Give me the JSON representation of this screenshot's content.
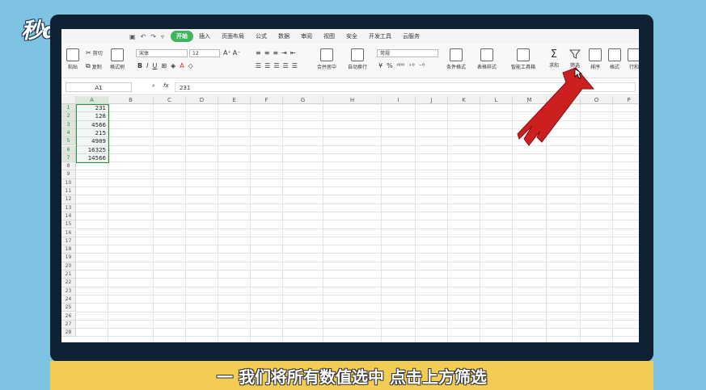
{
  "logo": {
    "text": "秒dong视频"
  },
  "ribbon": {
    "active_tab": "开始",
    "tabs": [
      "插入",
      "页面布局",
      "公式",
      "数据",
      "审阅",
      "视图",
      "安全",
      "开发工具",
      "云服务"
    ]
  },
  "toolbar": {
    "paste": "粘贴",
    "cut": "剪切",
    "copy": "复制",
    "format_painter": "格式刷",
    "font_name": "宋体",
    "font_size": "12",
    "number_format": "常规",
    "merge_center": "合并居中",
    "wrap_text": "自动换行",
    "conditional_format": "条件格式",
    "table_style": "表格样式",
    "smart_tools": "智能工具箱",
    "sum": "求和",
    "filter": "筛选",
    "sort": "排序",
    "format": "格式",
    "rows_cols": "行和"
  },
  "formula_bar": {
    "name_box": "A1",
    "fx": "fx",
    "value": "231"
  },
  "sheet": {
    "columns": [
      "A",
      "B",
      "C",
      "D",
      "E",
      "F",
      "G",
      "H",
      "I",
      "J",
      "K",
      "L",
      "M",
      "N",
      "O",
      "P"
    ],
    "rows": [
      "1",
      "2",
      "3",
      "4",
      "5",
      "6",
      "7",
      "8",
      "9",
      "10",
      "11",
      "12",
      "13",
      "14",
      "15",
      "16",
      "17",
      "18",
      "19",
      "20",
      "21",
      "22",
      "23",
      "24",
      "25",
      "26",
      "27",
      "28"
    ],
    "values": [
      "231",
      "128",
      "4566",
      "215",
      "4989",
      "16325",
      "14566"
    ]
  },
  "subtitle": "一 我们将所有数值选中 点击上方筛选",
  "colors": {
    "accent_green": "#3eb55d",
    "arrow_red": "#cc1f1f",
    "subtitle_bg": "#f2cc55"
  }
}
